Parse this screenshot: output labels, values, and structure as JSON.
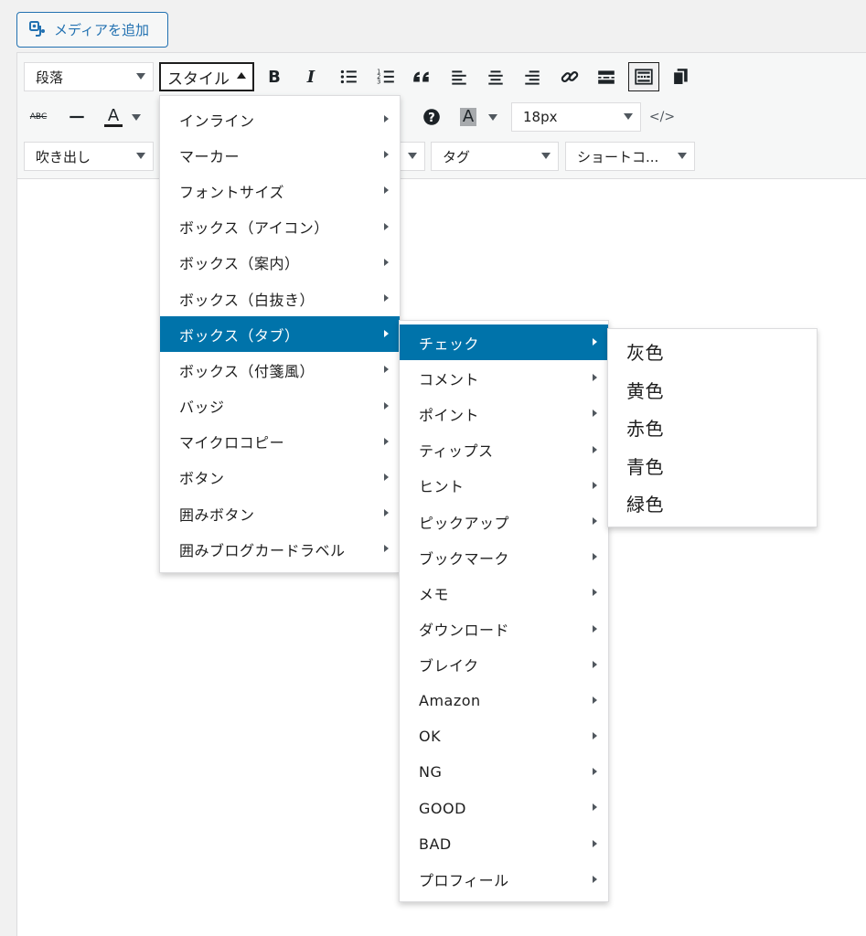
{
  "media_button": {
    "label": "メディアを追加",
    "icon": "media-icon"
  },
  "toolbar": {
    "format_select": "段落",
    "style_select": "スタイル",
    "fontsize_select": "18px",
    "balloon_select": "吹き出し",
    "tag_select": "タグ",
    "shortcode_select": "ショートコ...",
    "strike_label": "ABC",
    "forecolor_label": "A",
    "backcolor_label": "A",
    "bold_label": "B",
    "italic_label": "I",
    "code_label": "</>",
    "colors": {
      "accent": "#0073aa",
      "forecolor_bar": "#1e1e1e",
      "backcolor_bg": "#a7aaad"
    }
  },
  "style_menu": {
    "items": [
      {
        "label": "インライン"
      },
      {
        "label": "マーカー"
      },
      {
        "label": "フォントサイズ"
      },
      {
        "label": "ボックス（アイコン）"
      },
      {
        "label": "ボックス（案内）"
      },
      {
        "label": "ボックス（白抜き）"
      },
      {
        "label": "ボックス（タブ）",
        "selected": true
      },
      {
        "label": "ボックス（付箋風）"
      },
      {
        "label": "バッジ"
      },
      {
        "label": "マイクロコピー"
      },
      {
        "label": "ボタン"
      },
      {
        "label": "囲みボタン"
      },
      {
        "label": "囲みブログカードラベル"
      }
    ]
  },
  "tab_menu": {
    "items": [
      {
        "label": "チェック",
        "selected": true
      },
      {
        "label": "コメント"
      },
      {
        "label": "ポイント"
      },
      {
        "label": "ティップス"
      },
      {
        "label": "ヒント"
      },
      {
        "label": "ピックアップ"
      },
      {
        "label": "ブックマーク"
      },
      {
        "label": "メモ"
      },
      {
        "label": "ダウンロード"
      },
      {
        "label": "ブレイク"
      },
      {
        "label": "Amazon"
      },
      {
        "label": "OK"
      },
      {
        "label": "NG"
      },
      {
        "label": "GOOD"
      },
      {
        "label": "BAD"
      },
      {
        "label": "プロフィール"
      }
    ]
  },
  "color_menu": {
    "items": [
      {
        "label": "灰色"
      },
      {
        "label": "黄色"
      },
      {
        "label": "赤色"
      },
      {
        "label": "青色"
      },
      {
        "label": "緑色"
      }
    ]
  }
}
